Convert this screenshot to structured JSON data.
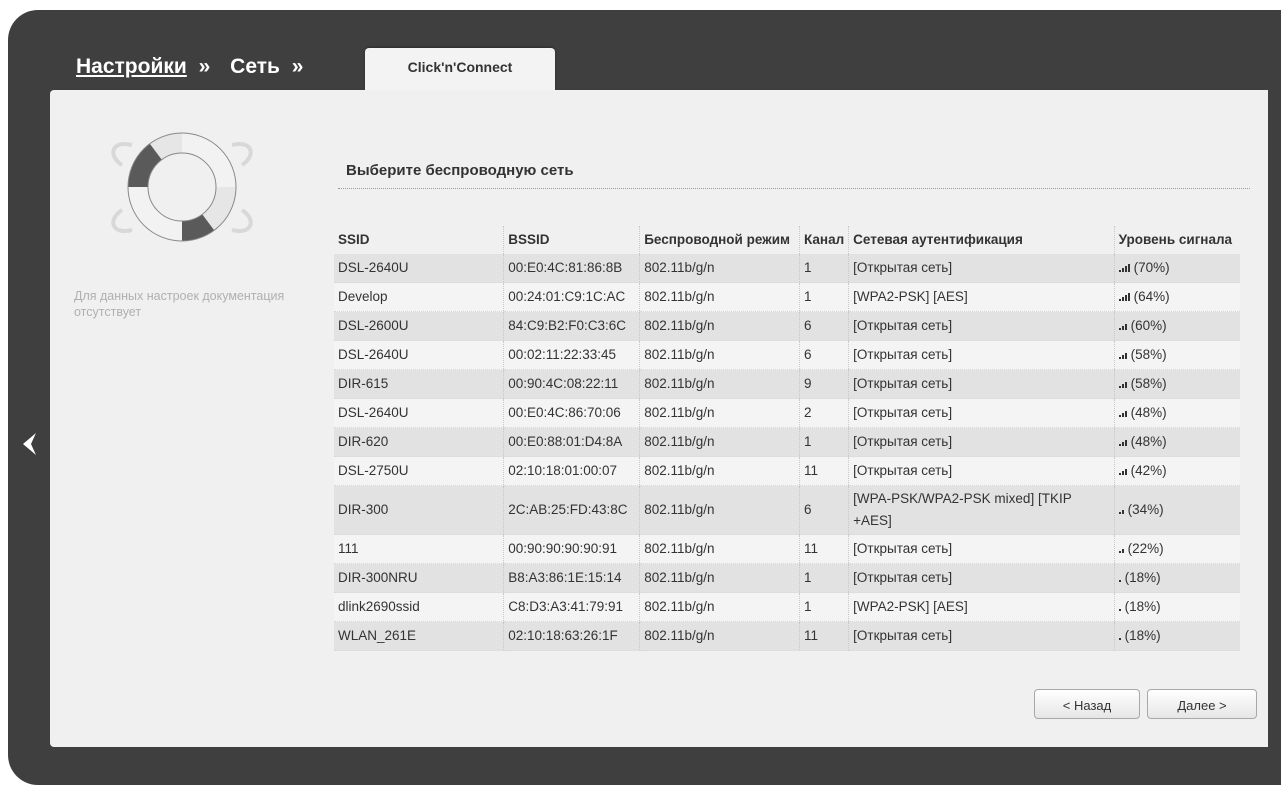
{
  "breadcrumb": {
    "items": [
      "Настройки",
      "Сеть"
    ],
    "separator": "»",
    "active_tab": "Click'n'Connect"
  },
  "help": {
    "text": "Для данных настроек документация отсутствует"
  },
  "section": {
    "title": "Выберите беспроводную сеть"
  },
  "table": {
    "headers": {
      "ssid": "SSID",
      "bssid": "BSSID",
      "mode": "Беспроводной режим",
      "channel": "Канал",
      "auth": "Сетевая аутентификация",
      "signal": "Уровень сигнала"
    },
    "rows": [
      {
        "ssid": "DSL-2640U",
        "bssid": "00:E0:4C:81:86:8B",
        "mode": "802.11b/g/n",
        "channel": "1",
        "auth": "[Открытая сеть]",
        "signal": "(70%)",
        "bars": 4
      },
      {
        "ssid": "Develop",
        "bssid": "00:24:01:C9:1C:AC",
        "mode": "802.11b/g/n",
        "channel": "1",
        "auth": "[WPA2-PSK] [AES]",
        "signal": "(64%)",
        "bars": 4
      },
      {
        "ssid": "DSL-2600U",
        "bssid": "84:C9:B2:F0:C3:6C",
        "mode": "802.11b/g/n",
        "channel": "6",
        "auth": "[Открытая сеть]",
        "signal": "(60%)",
        "bars": 3
      },
      {
        "ssid": "DSL-2640U",
        "bssid": "00:02:11:22:33:45",
        "mode": "802.11b/g/n",
        "channel": "6",
        "auth": "[Открытая сеть]",
        "signal": "(58%)",
        "bars": 3
      },
      {
        "ssid": "DIR-615",
        "bssid": "00:90:4C:08:22:11",
        "mode": "802.11b/g/n",
        "channel": "9",
        "auth": "[Открытая сеть]",
        "signal": "(58%)",
        "bars": 3
      },
      {
        "ssid": "DSL-2640U",
        "bssid": "00:E0:4C:86:70:06",
        "mode": "802.11b/g/n",
        "channel": "2",
        "auth": "[Открытая сеть]",
        "signal": "(48%)",
        "bars": 3
      },
      {
        "ssid": "DIR-620",
        "bssid": "00:E0:88:01:D4:8A",
        "mode": "802.11b/g/n",
        "channel": "1",
        "auth": "[Открытая сеть]",
        "signal": "(48%)",
        "bars": 3
      },
      {
        "ssid": "DSL-2750U",
        "bssid": "02:10:18:01:00:07",
        "mode": "802.11b/g/n",
        "channel": "11",
        "auth": "[Открытая сеть]",
        "signal": "(42%)",
        "bars": 3
      },
      {
        "ssid": "DIR-300",
        "bssid": "2C:AB:25:FD:43:8C",
        "mode": "802.11b/g/n",
        "channel": "6",
        "auth": "[WPA-PSK/WPA2-PSK mixed] [TKIP +AES]",
        "signal": "(34%)",
        "bars": 2
      },
      {
        "ssid": "111",
        "bssid": "00:90:90:90:90:91",
        "mode": "802.11b/g/n",
        "channel": "11",
        "auth": "[Открытая сеть]",
        "signal": "(22%)",
        "bars": 2
      },
      {
        "ssid": "DIR-300NRU",
        "bssid": "B8:A3:86:1E:15:14",
        "mode": "802.11b/g/n",
        "channel": "1",
        "auth": "[Открытая сеть]",
        "signal": "(18%)",
        "bars": 1
      },
      {
        "ssid": "dlink2690ssid",
        "bssid": "C8:D3:A3:41:79:91",
        "mode": "802.11b/g/n",
        "channel": "1",
        "auth": "[WPA2-PSK] [AES]",
        "signal": "(18%)",
        "bars": 1
      },
      {
        "ssid": "WLAN_261E",
        "bssid": "02:10:18:63:26:1F",
        "mode": "802.11b/g/n",
        "channel": "11",
        "auth": "[Открытая сеть]",
        "signal": "(18%)",
        "bars": 1
      }
    ]
  },
  "buttons": {
    "back": "< Назад",
    "next": "Далее >"
  },
  "icons": {
    "nav_back": "chevron-left-icon",
    "help": "lifebuoy-icon",
    "signal": "signal-bars-icon"
  }
}
